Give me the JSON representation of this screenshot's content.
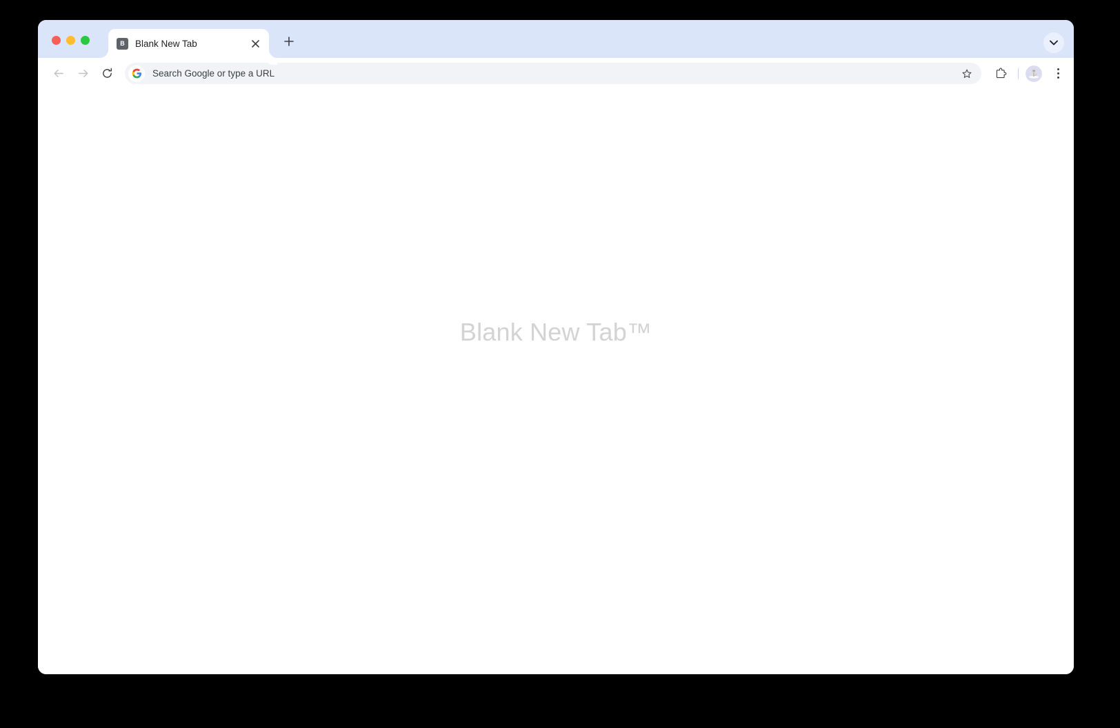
{
  "window": {
    "traffic_lights": [
      {
        "name": "close",
        "color": "#fa5e57"
      },
      {
        "name": "minimize",
        "color": "#febc2e"
      },
      {
        "name": "maximize",
        "color": "#2ac840"
      }
    ],
    "tabstrip_color": "#dbe5fa"
  },
  "tabstrip": {
    "tabs": [
      {
        "title": "Blank New Tab",
        "favicon_letter": "B",
        "favicon_bg": "#5f6368",
        "active": true,
        "close_icon": "close-icon"
      }
    ],
    "new_tab_icon": "plus-icon",
    "tab_search_icon": "chevron-down-icon"
  },
  "toolbar": {
    "back_icon": "arrow-left-icon",
    "forward_icon": "arrow-right-icon",
    "reload_icon": "reload-icon",
    "omnibox": {
      "value": "",
      "placeholder": "Search Google or type a URL",
      "leading_icon": "google-g-icon",
      "bookmark_icon": "star-outline-icon"
    },
    "extensions_icon": "puzzle-piece-icon",
    "profile_icon": "avatar-cat-icon",
    "menu_icon": "three-dot-menu-icon"
  },
  "page": {
    "watermark": "Blank New Tab™",
    "watermark_color": "#d3d3d3",
    "background": "#ffffff"
  }
}
